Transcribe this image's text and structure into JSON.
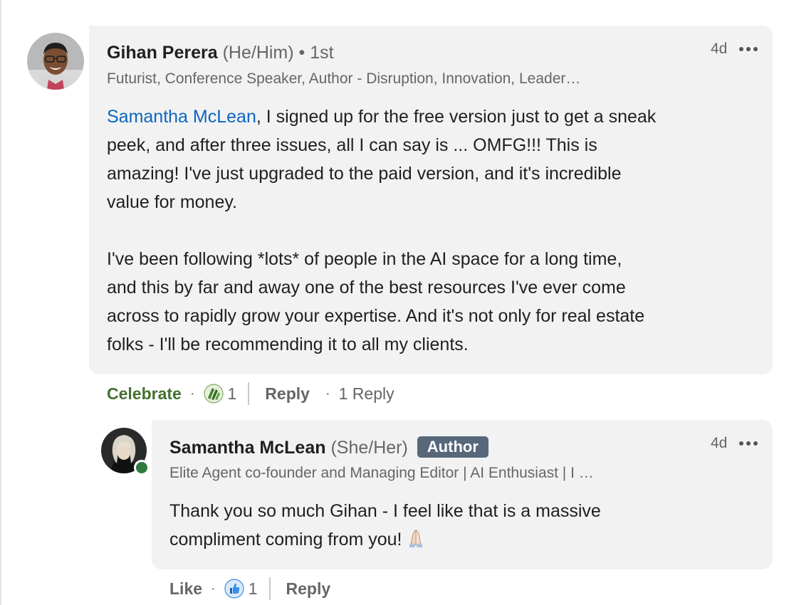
{
  "comment": {
    "author": {
      "name": "Gihan Perera",
      "pronouns": "(He/Him)",
      "degree": "• 1st",
      "headline": "Futurist, Conference Speaker, Author - Disruption, Innovation, Leader…"
    },
    "time": "4d",
    "mention": "Samantha McLean",
    "paragraph1_lines": [
      ", I signed up for the free version just to get a sneak",
      "peek, and after three issues, all I can say is ... OMFG!!! This is",
      "amazing! I've just upgraded to the paid version, and it's incredible",
      "value for money."
    ],
    "paragraph2_lines": [
      "I've been following *lots* of people in the AI space for a long time,",
      "and this by far and away one of the best resources I've ever come",
      "across to rapidly grow your expertise. And it's not only for real estate",
      "folks - I'll be recommending it to all my clients."
    ],
    "actions": {
      "reaction_label": "Celebrate",
      "reaction_icon": "celebrate-icon",
      "reaction_count": "1",
      "reply_label": "Reply",
      "reply_count": "1 Reply"
    }
  },
  "reply": {
    "author": {
      "name": "Samantha McLean",
      "pronouns": "(She/Her)",
      "badge": "Author",
      "headline": "Elite Agent co-founder and Managing Editor | AI Enthusiast | I …"
    },
    "time": "4d",
    "text_lines": [
      "Thank you so much Gihan - I feel like that is a massive",
      "compliment coming from you!"
    ],
    "emoji": "folded-hands-emoji",
    "actions": {
      "reaction_label": "Like",
      "reaction_icon": "like-icon",
      "reaction_count": "1",
      "reply_label": "Reply"
    }
  },
  "colors": {
    "mention": "#0a66c2",
    "celebrate": "#44712e",
    "bubble": "#f2f2f2",
    "author_badge": "#56687a",
    "online": "#2f7a3c"
  }
}
